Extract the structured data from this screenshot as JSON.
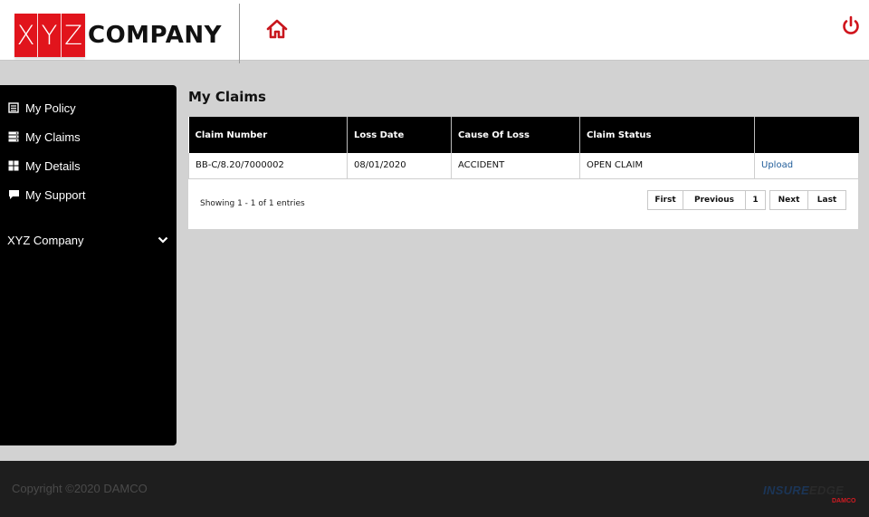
{
  "header": {
    "logo_letters": [
      "X",
      "Y",
      "Z"
    ],
    "logo_word": "COMPANY",
    "home_icon": "home-icon",
    "power_icon": "power-icon",
    "accent_color": "#e1141c"
  },
  "sidebar": {
    "items": [
      {
        "label": "My Policy",
        "icon": "policy-icon"
      },
      {
        "label": "My Claims",
        "icon": "claims-icon"
      },
      {
        "label": "My Details",
        "icon": "details-icon"
      },
      {
        "label": "My Support",
        "icon": "support-icon"
      }
    ],
    "company": "XYZ Company",
    "company_icon": "chevron-down-icon"
  },
  "main": {
    "title": "My Claims",
    "columns": [
      "Claim Number",
      "Loss Date",
      "Cause Of Loss",
      "Claim Status",
      ""
    ],
    "rows": [
      {
        "claim_number": "BB-C/8.20/7000002",
        "loss_date": "08/01/2020",
        "cause": "ACCIDENT",
        "status": "OPEN CLAIM",
        "action": "Upload"
      }
    ],
    "showing": "Showing 1 - 1 of 1 entries",
    "pager": {
      "first": "First",
      "previous": "Previous",
      "page": "1",
      "next": "Next",
      "last": "Last"
    }
  },
  "footer": {
    "copyright": "Copyright ©2020 DAMCO",
    "brand_a": "INSURE",
    "brand_b": "EDGE",
    "brand_sub": "DAMCO"
  }
}
